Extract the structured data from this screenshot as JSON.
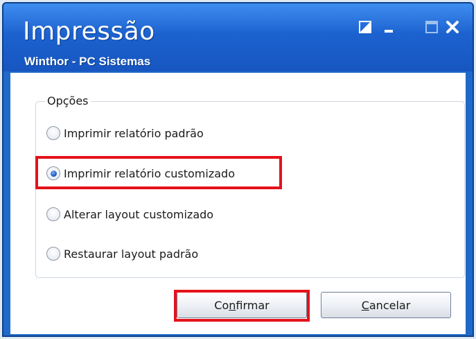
{
  "window": {
    "title": "Impressão",
    "subtitle": "Winthor - PC Sistemas",
    "controls": [
      "restore-icon",
      "minimize-icon",
      "maximize-icon",
      "close-icon"
    ]
  },
  "group": {
    "title": "Opções"
  },
  "options": [
    {
      "label": "Imprimir relatório padrão",
      "selected": false
    },
    {
      "label": "Imprimir relatório customizado",
      "selected": true
    },
    {
      "label": "Alterar layout customizado",
      "selected": false
    },
    {
      "label": "Restaurar layout padrão",
      "selected": false
    }
  ],
  "buttons": {
    "confirm": {
      "pre": "Co",
      "mnemonic": "n",
      "post": "firmar"
    },
    "cancel": {
      "pre": "",
      "mnemonic": "C",
      "post": "ancelar"
    }
  },
  "colors": {
    "titlebar": "#1f69c8",
    "highlight": "#e4121b"
  }
}
